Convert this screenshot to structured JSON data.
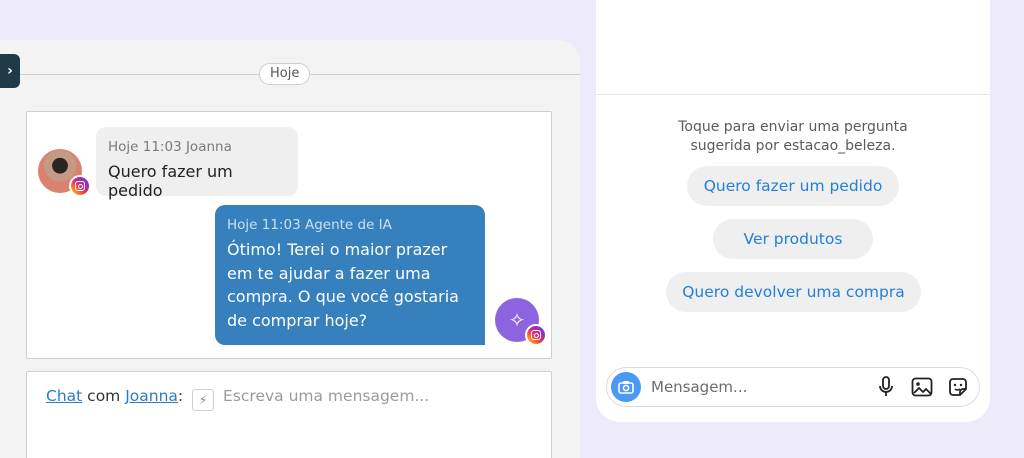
{
  "chat": {
    "date_label": "Hoje",
    "incoming": {
      "meta": "Hoje 11:03 Joanna",
      "text": "Quero fazer um pedido"
    },
    "outgoing": {
      "meta": "Hoje 11:03 Agente de IA",
      "text": "Ótimo! Terei o maior prazer em te ajudar a fazer uma compra. O que você gostaria de comprar hoje?"
    },
    "composer": {
      "chat_link": "Chat",
      "with_word": "com",
      "contact_link": "Joanna",
      "colon": ":",
      "placeholder": "Escreva uma mensagem..."
    }
  },
  "instagram": {
    "suggest_line1": "Toque para enviar uma pergunta",
    "suggest_line2": "sugerida por estacao_beleza.",
    "suggestions": [
      "Quero fazer um pedido",
      "Ver produtos",
      "Quero devolver uma compra"
    ],
    "input_placeholder": "Mensagem..."
  },
  "colors": {
    "accent_blue": "#3580bd",
    "ig_link_blue": "#2180d8",
    "ai_avatar": "#8e63e0"
  },
  "icons": [
    "chevron-right-icon",
    "instagram-icon",
    "sparkles-icon",
    "lightning-icon",
    "camera-icon",
    "microphone-icon",
    "image-icon",
    "sticker-icon"
  ]
}
